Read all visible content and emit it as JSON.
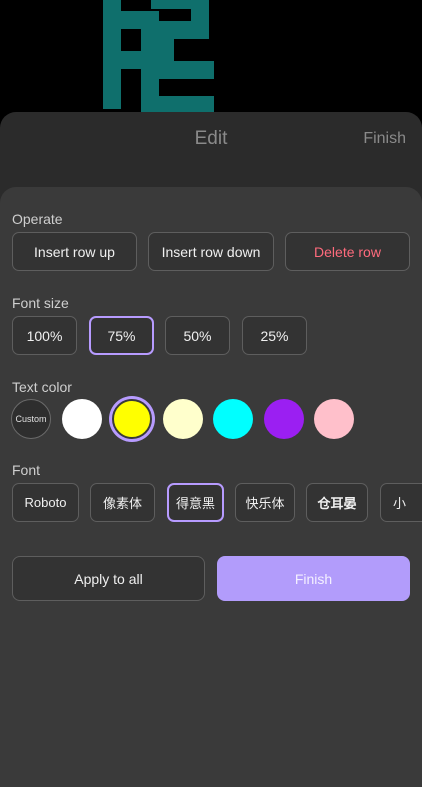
{
  "edit": {
    "title": "Edit",
    "finish_label": "Finish"
  },
  "operate": {
    "label": "Operate",
    "insert_up": "Insert row up",
    "insert_down": "Insert row down",
    "delete": "Delete row"
  },
  "font_size": {
    "label": "Font size",
    "options": [
      "100%",
      "75%",
      "50%",
      "25%"
    ],
    "selected": "75%"
  },
  "text_color": {
    "label": "Text color",
    "custom_label": "Custom",
    "swatches": [
      "#ffffff",
      "#ffff00",
      "#ffffcc",
      "#00ffff",
      "#9b1ff2",
      "#ffc0cb"
    ],
    "selected": "#ffff00"
  },
  "font": {
    "label": "Font",
    "options": [
      "Roboto",
      "像素体",
      "得意黑",
      "快乐体",
      "仓耳晏",
      "小"
    ],
    "selected": "得意黑"
  },
  "actions": {
    "apply_all": "Apply to all",
    "finish": "Finish"
  },
  "colors": {
    "accent": "#b79bff",
    "finish_bg": "#b29cfb",
    "danger": "#ff6b7d"
  }
}
